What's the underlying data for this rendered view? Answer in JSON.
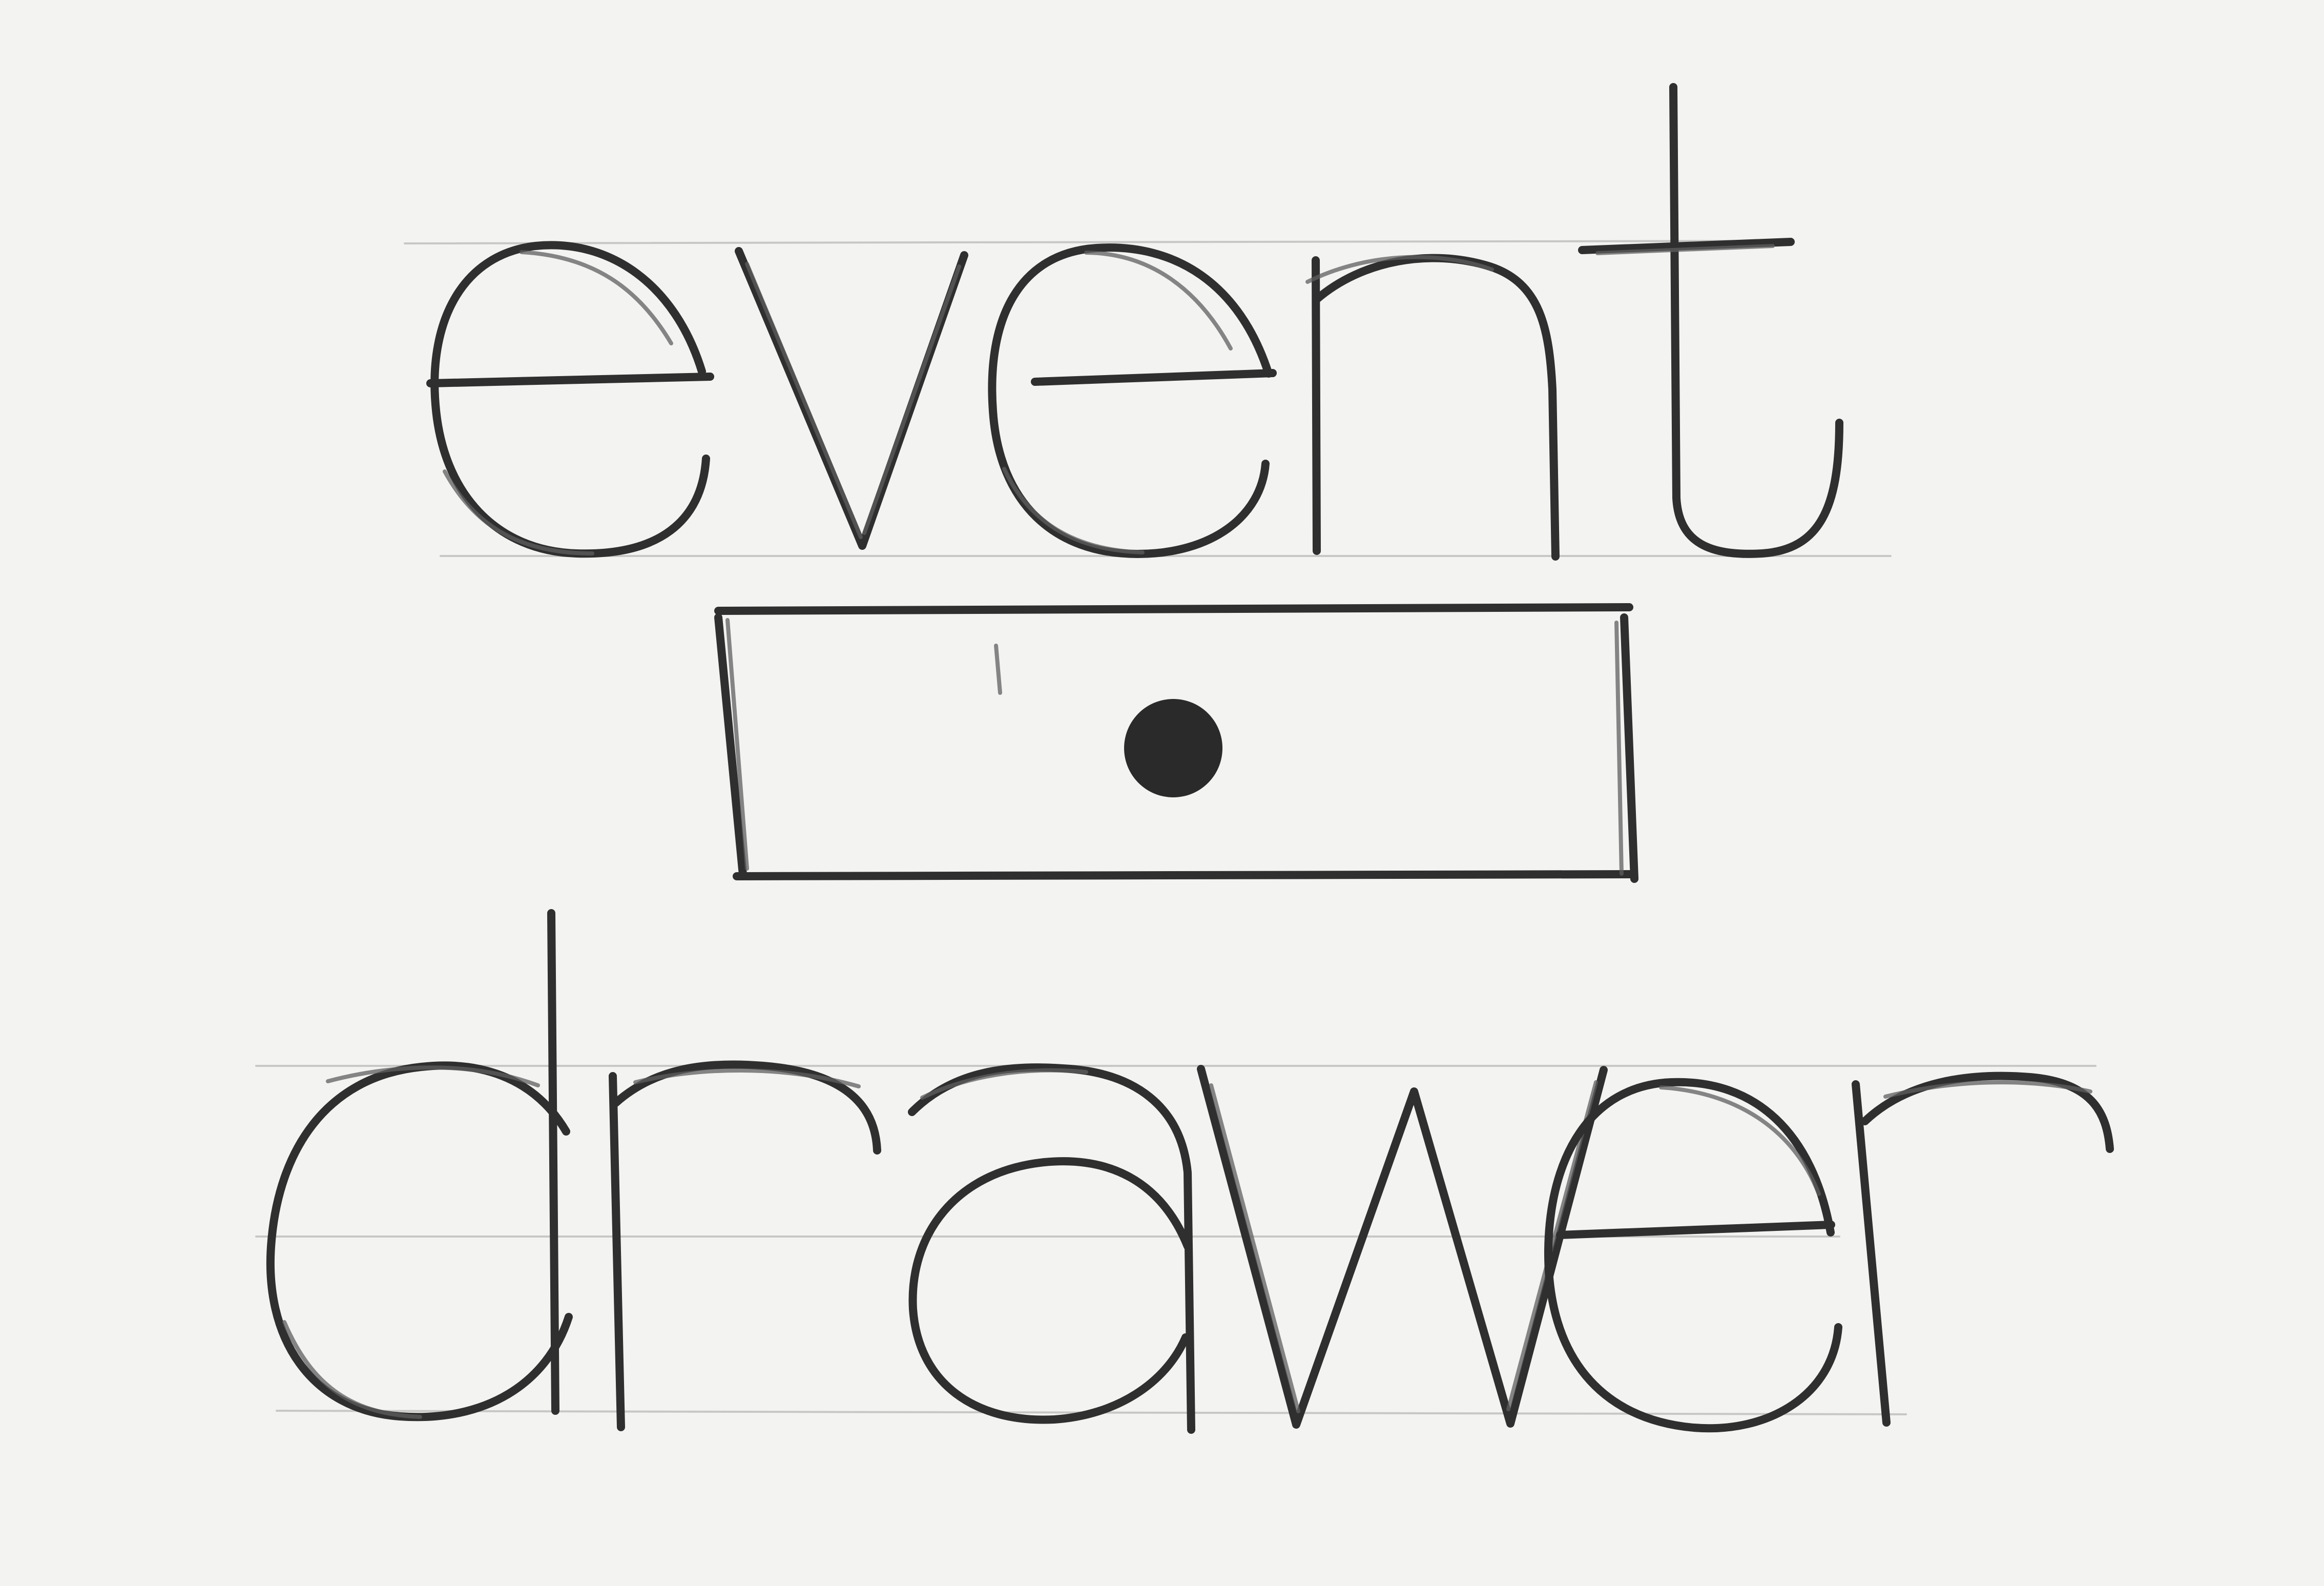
{
  "sketch": {
    "lines": [
      "event",
      "drawer"
    ],
    "colors": {
      "paper": "#f3f3f1",
      "pencil": "#2f2f2f",
      "guide": "#b8b8b6"
    },
    "symbol": "drawer-icon"
  }
}
